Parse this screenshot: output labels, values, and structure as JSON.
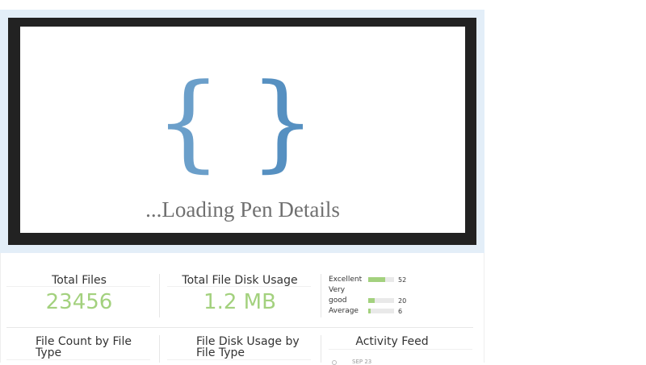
{
  "preview": {
    "brace_open": "{",
    "brace_close": "}",
    "loading_text": "...Loading Pen Details"
  },
  "stats": {
    "total_files_title": "Total Files",
    "total_files_value": "23456",
    "disk_usage_title": "Total File Disk Usage",
    "disk_usage_value": "1.2 MB"
  },
  "ratings": [
    {
      "label": "Excellent",
      "count": "52",
      "fraction": 0.65
    },
    {
      "label": "Very",
      "count": "",
      "fraction": null
    },
    {
      "label": "good",
      "count": "20",
      "fraction": 0.25
    },
    {
      "label": "Average",
      "count": "6",
      "fraction": 0.08
    }
  ],
  "panels": {
    "file_count_title": "File Count by File Type",
    "file_disk_title": "File Disk Usage by File Type",
    "activity_title": "Activity Feed",
    "activity_first_date": "SEP 23"
  },
  "colors": {
    "accent_green": "#a3d17e",
    "brace_blue": "#5e96c5"
  }
}
